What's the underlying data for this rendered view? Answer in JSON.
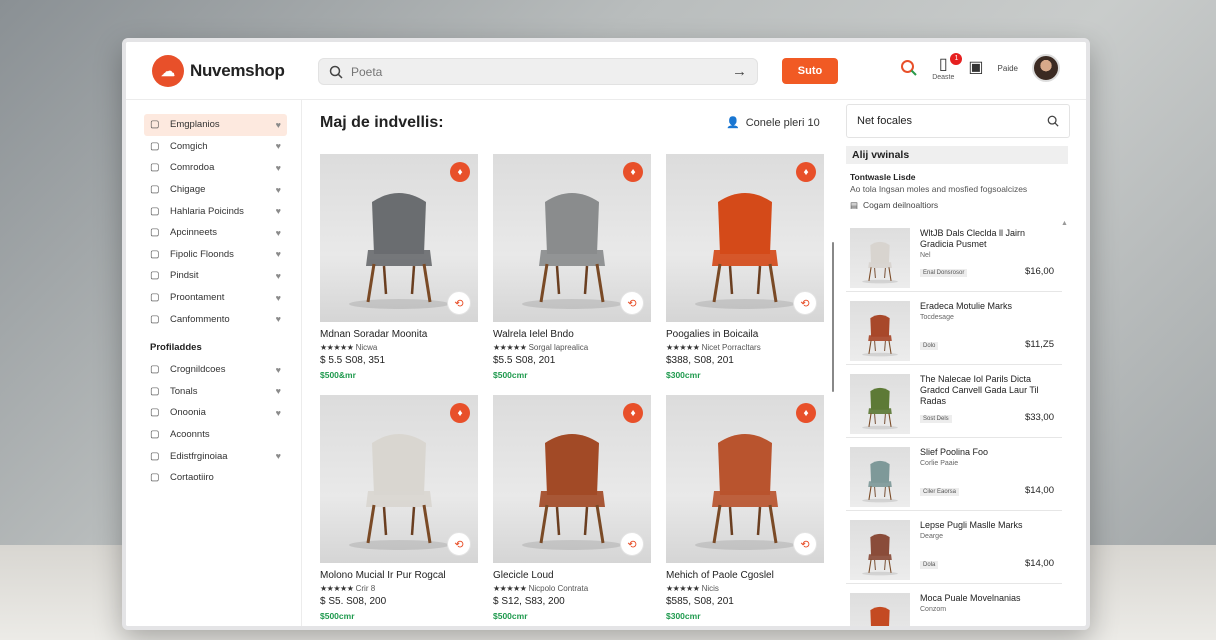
{
  "app": {
    "brand": "Nuvemshop",
    "search_placeholder": "Poeta",
    "cta_label": "Suto",
    "header": {
      "icon2_label": "Deaste",
      "badge": "1",
      "icon3_label": "Paide"
    }
  },
  "sidebar": {
    "items": [
      {
        "label": "Emgplanios",
        "icon": "store-icon"
      },
      {
        "label": "Comgich",
        "icon": "copy-icon"
      },
      {
        "label": "Comrodoa",
        "icon": "chat-icon"
      },
      {
        "label": "Chigage",
        "icon": "box-icon"
      },
      {
        "label": "Hahlaria Poicinds",
        "icon": "camera-icon"
      },
      {
        "label": "Apcinneets",
        "icon": "calendar-icon"
      },
      {
        "label": "Fipolic Floonds",
        "icon": "flag-icon"
      },
      {
        "label": "Pindsit",
        "icon": "user-icon"
      },
      {
        "label": "Proontament",
        "icon": "grid-icon"
      },
      {
        "label": "Canfommento",
        "icon": "card-icon"
      }
    ],
    "section_title": "Profiladdes",
    "section_items": [
      {
        "label": "Crognildcoes",
        "icon": "tag-icon"
      },
      {
        "label": "Tonals",
        "icon": "percent-icon"
      },
      {
        "label": "Onoonia",
        "icon": "list-icon"
      },
      {
        "label": "Acoonnts",
        "icon": "megaphone-icon"
      },
      {
        "label": "Edistfrginoiaa",
        "icon": "message-icon"
      },
      {
        "label": "Cortaotiiro",
        "icon": "bubble-icon"
      }
    ]
  },
  "main": {
    "title": "Maj de indvellis:",
    "sort_label": "Conele pleri 10",
    "products": [
      {
        "name": "Mdnan Soradar Moonita",
        "stars": "★★★★★",
        "rating_note": "Nicwa",
        "price": "$ 5.5 S08, 351",
        "shipping": "$500&mr",
        "color": "#6a6d70"
      },
      {
        "name": "Walrela Ielel Bndo",
        "stars": "★★★★★",
        "rating_note": "Sorgal laprealica",
        "price": "$5.5 S08, 201",
        "shipping": "$500cmr",
        "color": "#8a8c8d"
      },
      {
        "name": "Poogalies in Boicaila",
        "stars": "★★★★★",
        "rating_note": "Nicet Porracltars",
        "price": "$388, S08, 201",
        "shipping": "$300cmr",
        "color": "#d44a19"
      },
      {
        "name": "Molono Mucial Ir Pur Rogcal",
        "stars": "★★★★★",
        "rating_note": "Crir 8",
        "price": "$ S5. S08, 200",
        "shipping": "$500cmr",
        "color": "#d9d6d0"
      },
      {
        "name": "Glecicle Loud",
        "stars": "★★★★★",
        "rating_note": "Nicpolo Contrata",
        "price": "$ S12, S83, 200",
        "shipping": "$500cmr",
        "color": "#a24a26"
      },
      {
        "name": "Mehich of Paole Cgoslel",
        "stars": "★★★★★",
        "rating_note": "Nicis",
        "price": "$585, S08, 201",
        "shipping": "$300cmr",
        "color": "#b9542e"
      }
    ]
  },
  "right_panel": {
    "search_value": "Net focales",
    "title": "Alij vwinals",
    "subtitle": "Tontwasle Lisde",
    "desc": "Ao tola Ingsan moles and mosfied fogsoalcizes",
    "link": "Cogam deilnoaltiors",
    "items": [
      {
        "title": "WltJB Dals Cleclda ll Jairn Gradicia Pusmet",
        "meta": "Nel",
        "tag": "Enal Donsrosor",
        "price": "$16,00",
        "color": "#d8d4cf"
      },
      {
        "title": "Eradeca Motulie Marks",
        "meta": "Tocdesage",
        "tag": "Dolo",
        "price": "$11,Z5",
        "color": "#a8482a"
      },
      {
        "title": "The Nalecae Iol Parils Dicta Gradcd Canvell Gada Laur Til Radas",
        "meta": "",
        "tag": "Sost Dels",
        "price": "$33,00",
        "color": "#5d7a36"
      },
      {
        "title": "Slief Poolina Foo",
        "meta": "Corlie Paaie",
        "tag": "Ciler Eaorsa",
        "price": "$14,00",
        "color": "#7e9999"
      },
      {
        "title": "Lepse Pugli Maslle Marks",
        "meta": "Dearge",
        "tag": "Dola",
        "price": "$14,00",
        "color": "#8a4c3a"
      },
      {
        "title": "Moca Puale Movelnanias",
        "meta": "Conzom",
        "tag": "",
        "price": "",
        "color": "#c44a22"
      }
    ]
  }
}
